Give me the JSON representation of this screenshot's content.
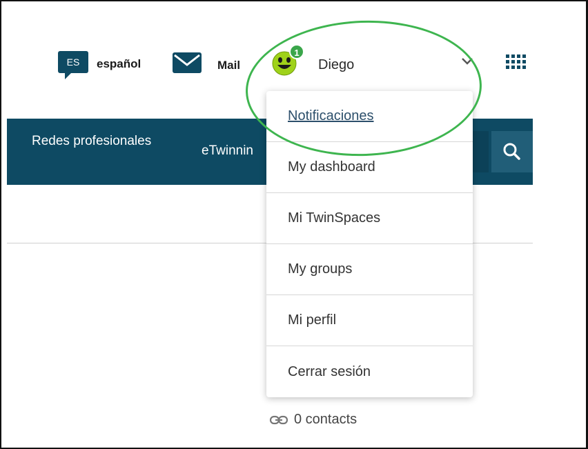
{
  "header": {
    "language_code": "ES",
    "language_label": "español",
    "mail_label": "Mail",
    "notification_count": "1",
    "user_name": "Diego"
  },
  "nav": {
    "items": [
      {
        "label": "Redes profesionales"
      },
      {
        "label": "eTwinnin"
      }
    ]
  },
  "dropdown": {
    "items": [
      {
        "label": "Notificaciones"
      },
      {
        "label": "My dashboard"
      },
      {
        "label": "Mi TwinSpaces"
      },
      {
        "label": "My groups"
      },
      {
        "label": "Mi perfil"
      },
      {
        "label": "Cerrar sesión"
      }
    ]
  },
  "contacts": {
    "label": "0 contacts"
  },
  "colors": {
    "brand": "#0e4a63",
    "highlight": "#3eb54f",
    "badge": "#3aa64a"
  }
}
